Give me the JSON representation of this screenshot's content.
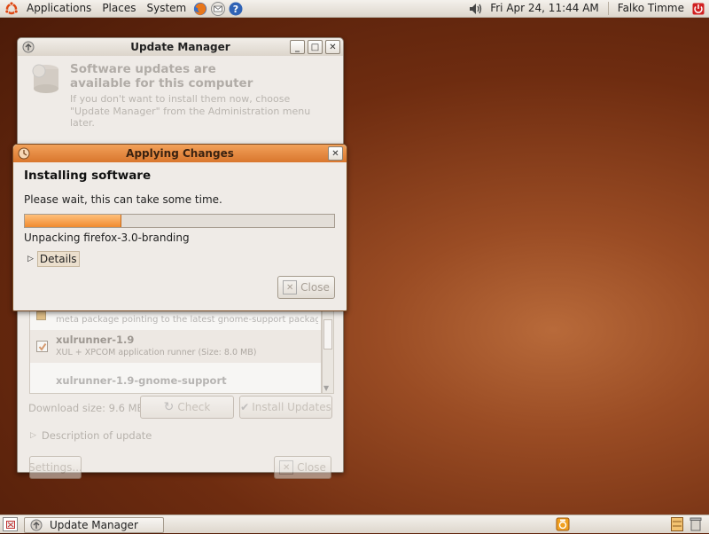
{
  "top_panel": {
    "menus": [
      "Applications",
      "Places",
      "System"
    ],
    "datetime": "Fri Apr 24, 11:44 AM",
    "user": "Falko Timme"
  },
  "update_manager": {
    "title": "Update Manager",
    "heading": "Software updates are available for this computer",
    "subtext": "If you don't want to install them now, choose \"Update Manager\" from the Administration menu later.",
    "rows": [
      {
        "description": "meta package pointing to the latest gnome-support package for fir"
      },
      {
        "name": "xulrunner-1.9",
        "description": "XUL + XPCOM application runner (Size: 8.0 MB)",
        "checked": true
      },
      {
        "name": "xulrunner-1.9-gnome-support"
      }
    ],
    "download_size": "Download size: 9.6 MB",
    "check_label": "Check",
    "install_label": "Install Updates",
    "description_toggle": "Description of update",
    "settings_label": "Settings...",
    "close_label": "Close"
  },
  "applying_changes": {
    "title": "Applying Changes",
    "heading": "Installing software",
    "message": "Please wait, this can take some time.",
    "progress": 0.31,
    "status": "Unpacking firefox-3.0-branding",
    "details_label": "Details",
    "close_label": "Close"
  },
  "taskbar": {
    "items": [
      {
        "label": "Update Manager"
      }
    ]
  },
  "colors": {
    "accent": "#f08a30",
    "desktop": "#7a3414"
  }
}
